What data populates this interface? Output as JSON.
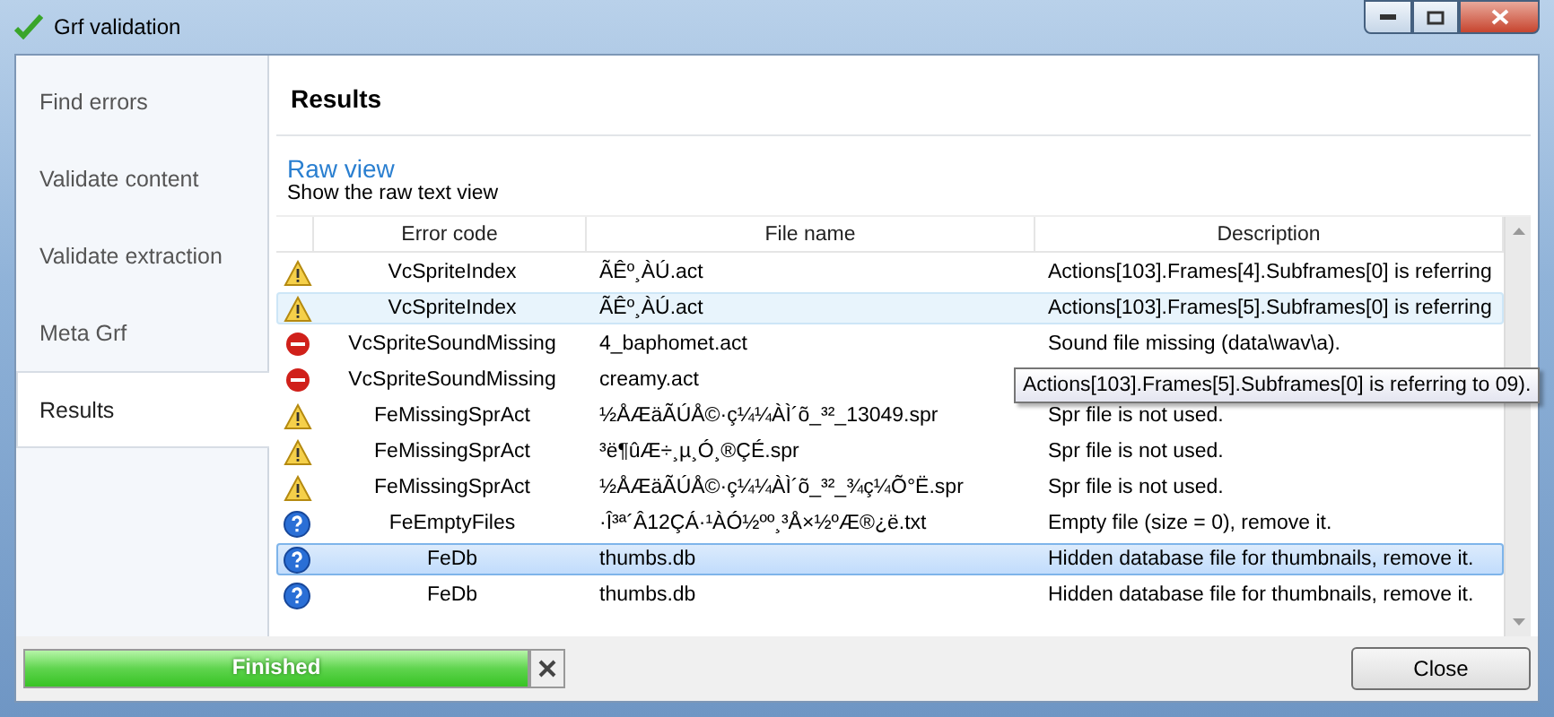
{
  "window": {
    "title": "Grf validation"
  },
  "sidebar": {
    "items": [
      {
        "label": "Find errors",
        "selected": false
      },
      {
        "label": "Validate content",
        "selected": false
      },
      {
        "label": "Validate extraction",
        "selected": false
      },
      {
        "label": "Meta Grf",
        "selected": false
      },
      {
        "label": "Results",
        "selected": true
      }
    ]
  },
  "page": {
    "title": "Results",
    "link": "Raw view",
    "link_hint": "Show the raw text view"
  },
  "table": {
    "columns": [
      "Error code",
      "File name",
      "Description"
    ],
    "rows": [
      {
        "kind": "warning",
        "code": "VcSpriteIndex",
        "file": "ÃÊº¸ÀÚ.act",
        "description": "Actions[103].Frames[4].Subframes[0] is referring",
        "selected": false,
        "hovered": false
      },
      {
        "kind": "warning",
        "code": "VcSpriteIndex",
        "file": "ÃÊº¸ÀÚ.act",
        "description": "Actions[103].Frames[5].Subframes[0] is referring",
        "selected": false,
        "hovered": true
      },
      {
        "kind": "error",
        "code": "VcSpriteSoundMissing",
        "file": "4_baphomet.act",
        "description": "Sound file missing (data\\wav\\a).",
        "selected": false,
        "hovered": false
      },
      {
        "kind": "error",
        "code": "VcSpriteSoundMissing",
        "file": "creamy.act",
        "selected": false,
        "hovered": false
      },
      {
        "kind": "warning",
        "code": "FeMissingSprAct",
        "file": "½ÅÆäÃÚÅ©·ç¼¼ÀÌ´õ_³²_13049.spr",
        "description": "Spr file is not used.",
        "selected": false,
        "hovered": false
      },
      {
        "kind": "warning",
        "code": "FeMissingSprAct",
        "file": "³ë¶ûÆ÷¸µ¸Ó¸®ÇÉ.spr",
        "description": "Spr file is not used.",
        "selected": false,
        "hovered": false
      },
      {
        "kind": "warning",
        "code": "FeMissingSprAct",
        "file": "½ÅÆäÃÚÅ©·ç¼¼ÀÌ´õ_³²_¾ç¼Õ°Ë.spr",
        "description": "Spr file is not used.",
        "selected": false,
        "hovered": false
      },
      {
        "kind": "info",
        "code": "FeEmptyFiles",
        "file": "·Î³ª´Â12ÇÁ·¹ÀÓ½ºº¸³Å×½ºÆ®¿ë.txt",
        "description": "Empty file (size = 0), remove it.",
        "selected": false,
        "hovered": false
      },
      {
        "kind": "info",
        "code": "FeDb",
        "file": "thumbs.db",
        "description": "Hidden database file for thumbnails, remove it.",
        "selected": true,
        "hovered": false
      },
      {
        "kind": "info",
        "code": "FeDb",
        "file": "thumbs.db",
        "description": "Hidden database file for thumbnails, remove it.",
        "selected": false,
        "hovered": false
      }
    ]
  },
  "tooltip": "Actions[103].Frames[5].Subframes[0] is referring to 09).",
  "progress": {
    "label": "Finished",
    "level": 1
  },
  "buttons": [
    "Close"
  ]
}
